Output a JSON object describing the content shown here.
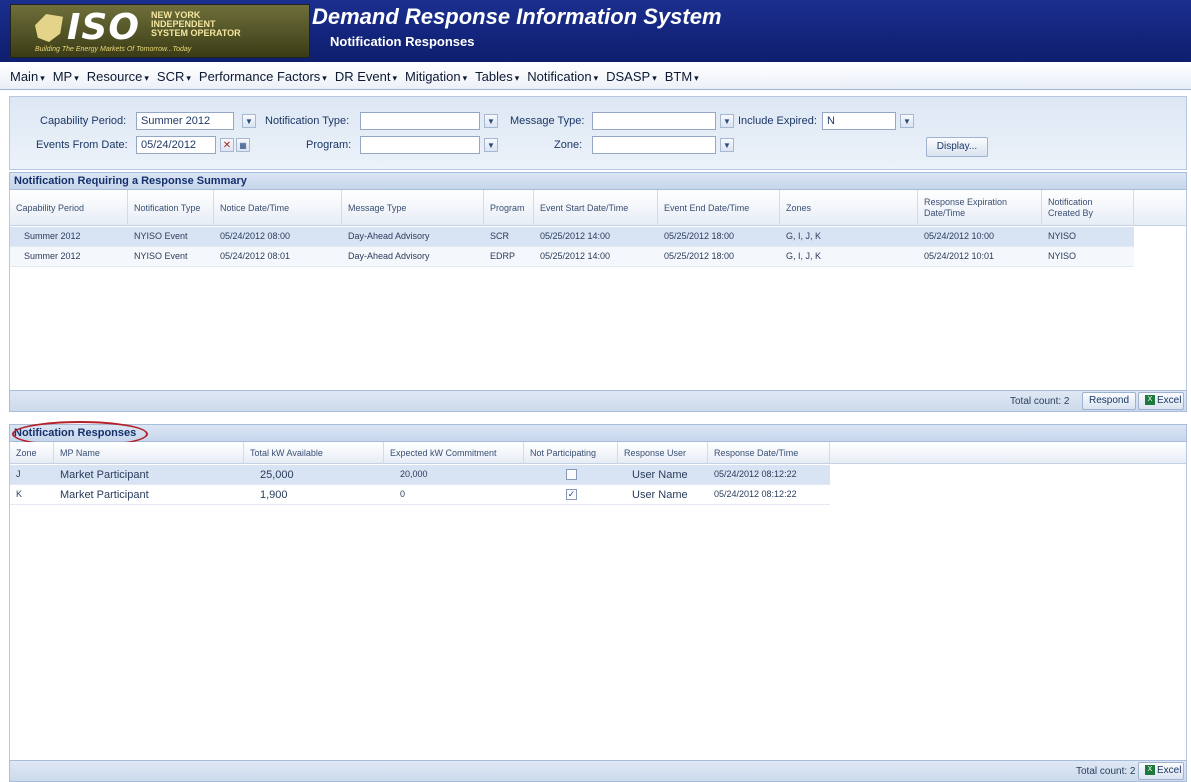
{
  "header": {
    "logo": {
      "wordmark": "ISO",
      "org_line1": "NEW YORK",
      "org_line2": "INDEPENDENT",
      "org_line3": "SYSTEM OPERATOR",
      "tagline": "Building The Energy Markets Of Tomorrow...Today"
    },
    "app_title": "Demand Response Information System",
    "page_title": "Notification Responses"
  },
  "menu": {
    "items": [
      {
        "label": "Main"
      },
      {
        "label": "MP"
      },
      {
        "label": "Resource"
      },
      {
        "label": "SCR"
      },
      {
        "label": "Performance Factors"
      },
      {
        "label": "DR Event"
      },
      {
        "label": "Mitigation"
      },
      {
        "label": "Tables"
      },
      {
        "label": "Notification"
      },
      {
        "label": "DSASP"
      },
      {
        "label": "BTM"
      }
    ],
    "caret": "▾"
  },
  "filters": {
    "capability_period": {
      "label": "Capability Period:",
      "value": "Summer 2012"
    },
    "notification_type": {
      "label": "Notification Type:",
      "value": ""
    },
    "message_type": {
      "label": "Message Type:",
      "value": ""
    },
    "include_expired": {
      "label": "Include Expired:",
      "value": "N"
    },
    "events_from_date": {
      "label": "Events From Date:",
      "value": "05/24/2012"
    },
    "program": {
      "label": "Program:",
      "value": ""
    },
    "zone": {
      "label": "Zone:",
      "value": ""
    },
    "display_button": "Display..."
  },
  "summary": {
    "title": "Notification Requiring a Response Summary",
    "columns": [
      "Capability Period",
      "Notification Type",
      "Notice Date/Time",
      "Message Type",
      "Program",
      "Event Start Date/Time",
      "Event End Date/Time",
      "Zones",
      "Response Expiration Date/Time",
      "Notification Created By"
    ],
    "rows": [
      [
        "Summer 2012",
        "NYISO Event",
        "05/24/2012 08:00",
        "Day-Ahead Advisory",
        "SCR",
        "05/25/2012 14:00",
        "05/25/2012 18:00",
        "G, I, J, K",
        "05/24/2012 10:00",
        "NYISO"
      ],
      [
        "Summer 2012",
        "NYISO Event",
        "05/24/2012 08:01",
        "Day-Ahead Advisory",
        "EDRP",
        "05/25/2012 14:00",
        "05/25/2012 18:00",
        "G, I, J, K",
        "05/24/2012 10:01",
        "NYISO"
      ]
    ],
    "total_count": "Total count: 2",
    "respond_button": "Respond",
    "excel_button": "Excel"
  },
  "responses": {
    "title": "Notification Responses",
    "columns": [
      "Zone",
      "MP Name",
      "Total kW Available",
      "Expected kW Commitment",
      "Not Participating",
      "Response User",
      "Response Date/Time"
    ],
    "rows": [
      {
        "zone": "J",
        "mp_name": "Market Participant",
        "total_kw": "25,000",
        "expected_kw": "20,000",
        "not_participating": false,
        "user": "User Name",
        "datetime": "05/24/2012 08:12:22"
      },
      {
        "zone": "K",
        "mp_name": "Market Participant",
        "total_kw": "1,900",
        "expected_kw": "0",
        "not_participating": true,
        "user": "User Name",
        "datetime": "05/24/2012 08:12:22"
      }
    ],
    "total_count": "Total count: 2",
    "excel_button": "Excel"
  },
  "colors": {
    "header_bg": "#12247a",
    "highlight_oval": "#b3202a",
    "selected_row": "#d8e4f4"
  }
}
